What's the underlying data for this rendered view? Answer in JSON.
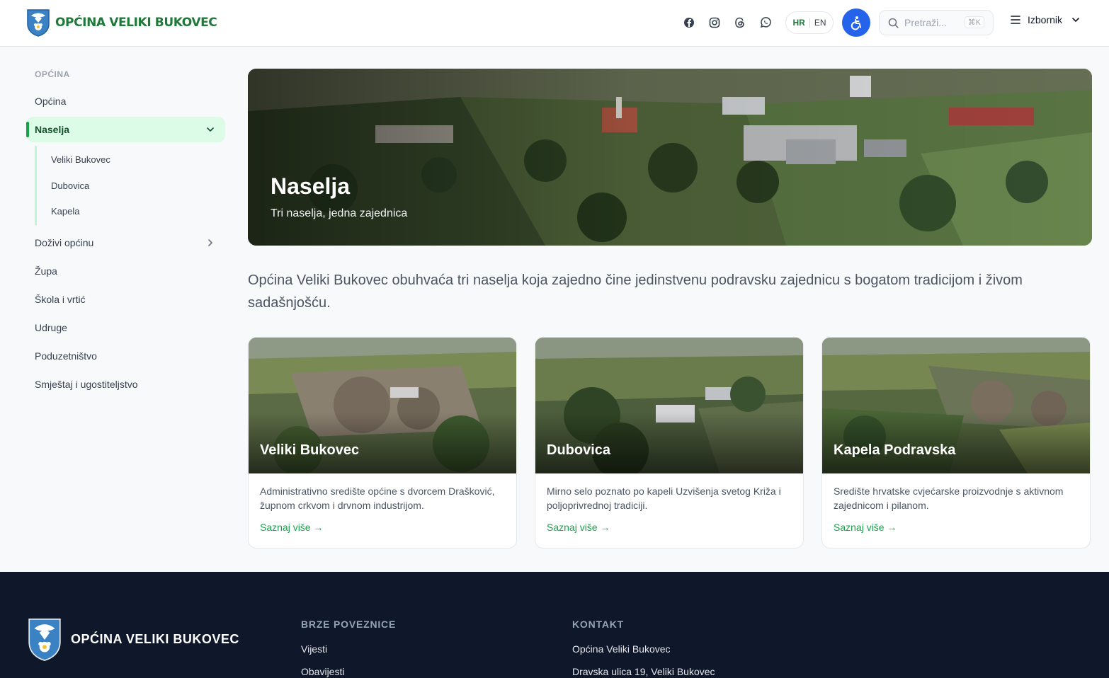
{
  "header": {
    "site_name": "OPĆINA VELIKI BUKOVEC",
    "lang_hr": "HR",
    "lang_en": "EN",
    "search_placeholder": "Pretraži...",
    "search_shortcut": "⌘K",
    "menu_label": "Izbornik"
  },
  "sidebar": {
    "heading": "OPĆINA",
    "items": [
      {
        "label": "Općina"
      },
      {
        "label": "Naselja"
      },
      {
        "label": "Doživi općinu"
      },
      {
        "label": "Župa"
      },
      {
        "label": "Škola i vrtić"
      },
      {
        "label": "Udruge"
      },
      {
        "label": "Poduzetništvo"
      },
      {
        "label": "Smještaj i ugostiteljstvo"
      }
    ],
    "subitems": [
      {
        "label": "Veliki Bukovec"
      },
      {
        "label": "Dubovica"
      },
      {
        "label": "Kapela"
      }
    ]
  },
  "hero": {
    "title": "Naselja",
    "subtitle": "Tri naselja, jedna zajednica"
  },
  "intro": "Općina Veliki Bukovec obuhvaća tri naselja koja zajedno čine jedinstvenu podravsku zajednicu s bogatom tradicijom i živom sadašnjošću.",
  "cards": [
    {
      "title": "Veliki Bukovec",
      "desc": "Administrativno središte općine s dvorcem Drašković, župnom crkvom i drvnom industrijom.",
      "link": "Saznaj više →"
    },
    {
      "title": "Dubovica",
      "desc": "Mirno selo poznato po kapeli Uzvišenja svetog Križa i poljoprivrednoj tradiciji.",
      "link": "Saznaj više →"
    },
    {
      "title": "Kapela Podravska",
      "desc": "Središte hrvatske cvjećarske proizvodnje s aktivnom zajednicom i pilanom.",
      "link": "Saznaj više →"
    }
  ],
  "footer": {
    "name": "OPĆINA VELIKI BUKOVEC",
    "quick_links_heading": "BRZE POVEZNICE",
    "quick_links": [
      "Vijesti",
      "Obavijesti"
    ],
    "contact_heading": "KONTAKT",
    "contact": [
      "Općina Veliki Bukovec",
      "Dravska ulica 19, Veliki Bukovec"
    ]
  },
  "colors": {
    "brand_green": "#1f7a3a",
    "accent_blue": "#2563eb",
    "footer_bg": "#0f172a"
  }
}
